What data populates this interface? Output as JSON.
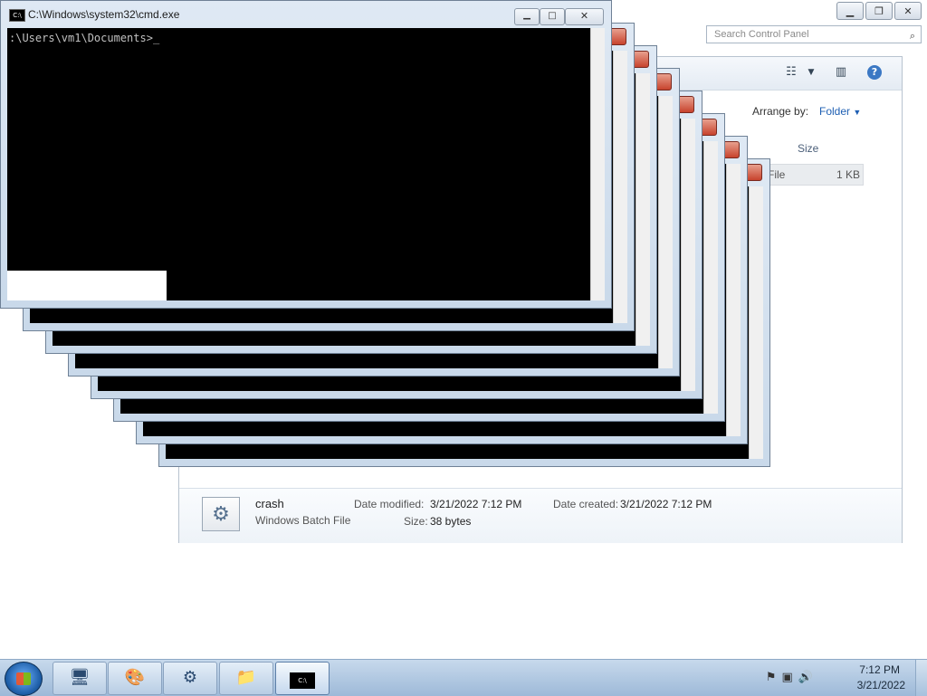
{
  "cmd": {
    "title": "C:\\Windows\\system32\\cmd.exe",
    "prompt": ":\\Users\\vm1\\Documents>",
    "icon_text": "C:\\"
  },
  "explorer": {
    "search_placeholder": "Search Control Panel",
    "arrange_label": "Arrange by:",
    "arrange_value": "Folder",
    "size_column": "Size",
    "row_type": "File",
    "row_size": "1 KB",
    "details": {
      "name": "crash",
      "type": "Windows Batch File",
      "date_modified_label": "Date modified:",
      "date_modified": "3/21/2022 7:12 PM",
      "size_label": "Size:",
      "size": "38 bytes",
      "date_created_label": "Date created:",
      "date_created": "3/21/2022 7:12 PM"
    }
  },
  "taskbar": {
    "time": "7:12 PM",
    "date": "3/21/2022",
    "buttons": [
      "remote-desktop",
      "paint",
      "control-panel",
      "explorer",
      "cmd"
    ]
  },
  "colors": {
    "console_bg": "#000000",
    "close_red": "#c7432d",
    "taskbar": "#b8cde4"
  }
}
